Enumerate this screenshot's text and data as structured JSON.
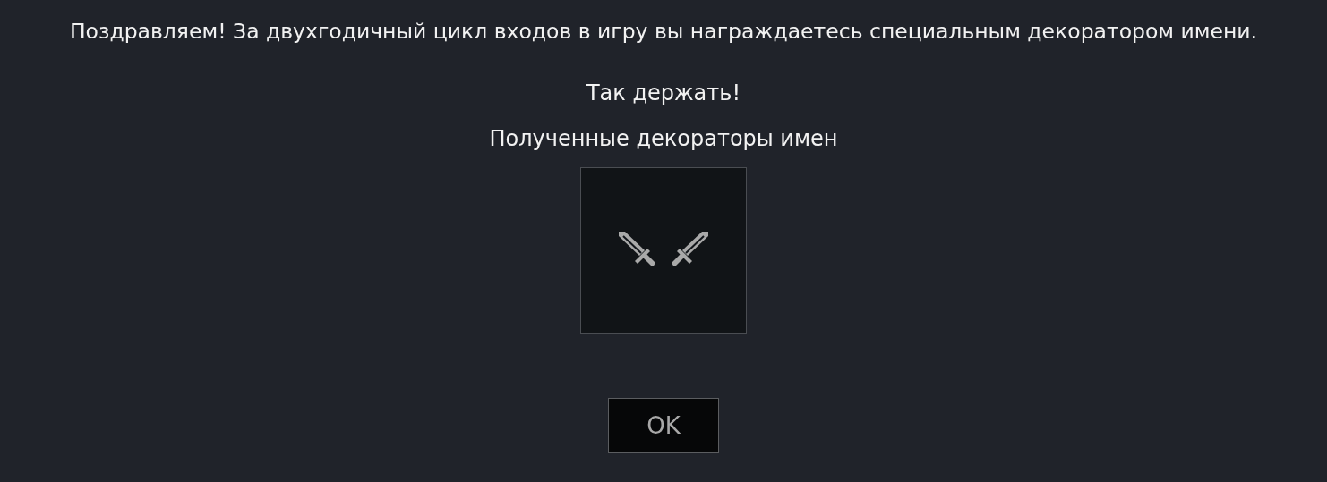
{
  "message": "Поздравляем! За двухгодичный цикл входов в игру вы награждаетесь специальным декоратором имени.",
  "subtitle": "Так держать!",
  "decorators": {
    "heading": "Полученные декораторы имен"
  },
  "buttons": [
    "OK"
  ]
}
